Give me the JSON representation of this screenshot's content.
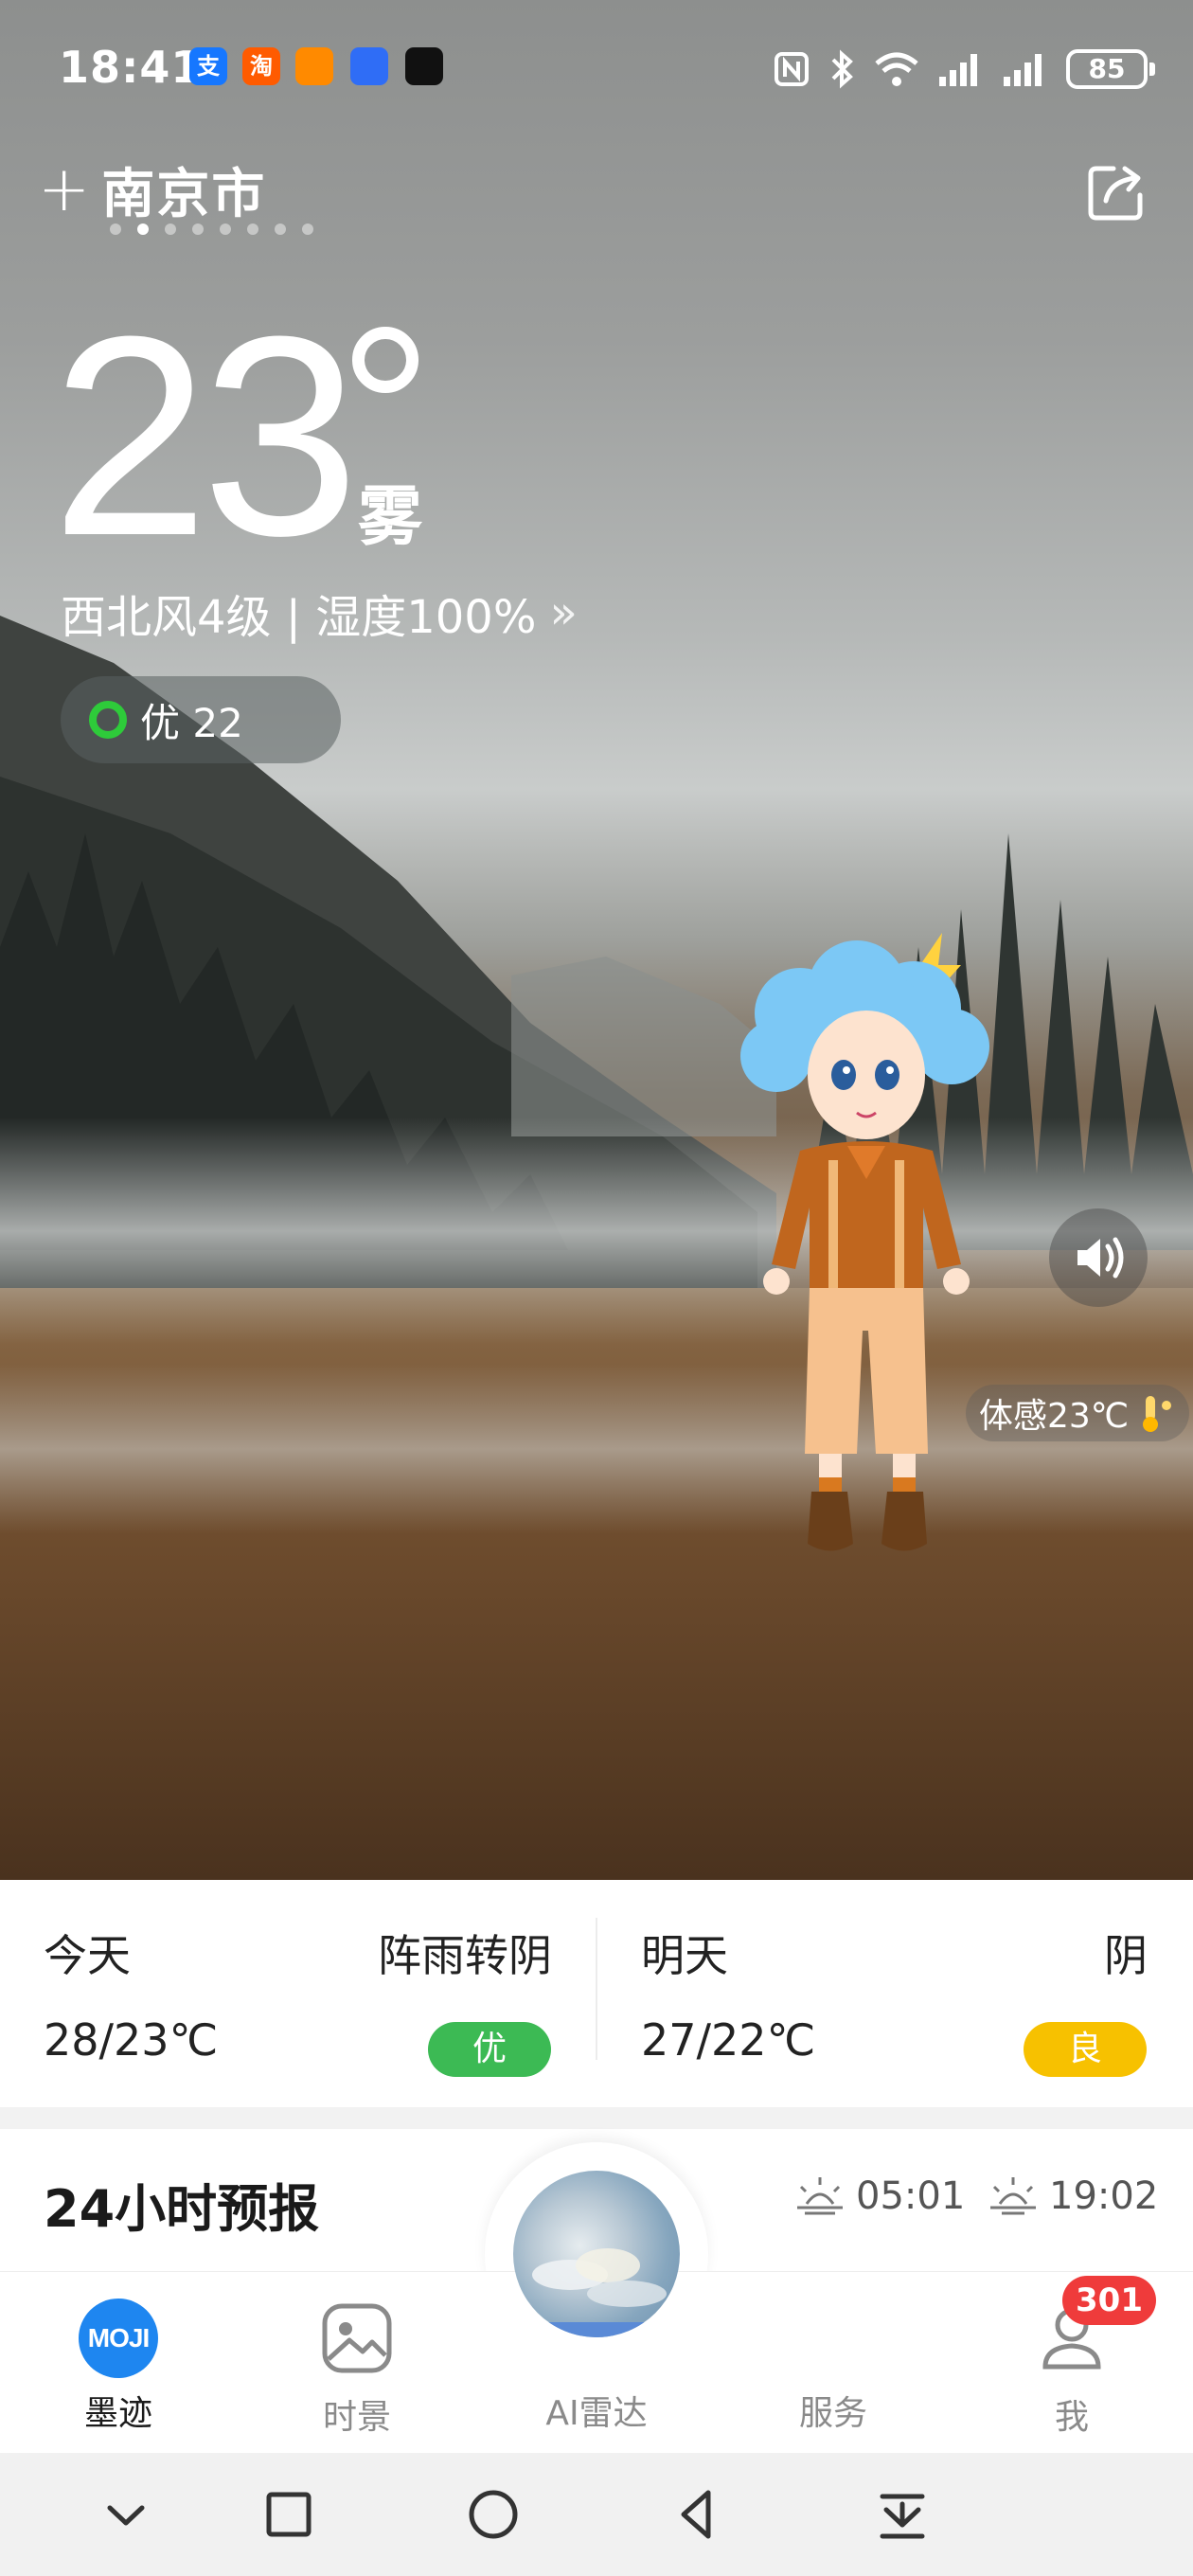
{
  "status_bar": {
    "time": "18:41",
    "app_icons": [
      "支",
      "淘",
      "",
      "",
      ""
    ],
    "battery": "85"
  },
  "header": {
    "add_symbol": "+",
    "city": "南京市",
    "page_count": 8,
    "active_page": 2
  },
  "current": {
    "temperature": "23",
    "condition": "雾",
    "wind_humidity": "西北风4级 | 湿度100%",
    "aqi_label": "优 22",
    "feels_like": "体感23℃"
  },
  "days": {
    "today": {
      "label": "今天",
      "condition": "阵雨转阴",
      "temp": "28/23℃",
      "aqi": "优",
      "aqi_color": "#3cba54"
    },
    "tomorrow": {
      "label": "明天",
      "condition": "阴",
      "temp": "27/22℃",
      "aqi": "良",
      "aqi_color": "#f7c100"
    }
  },
  "forecast": {
    "title": "24小时预报",
    "sunrise": "05:01",
    "sunset": "19:02"
  },
  "bottom_nav": {
    "items": [
      {
        "label": "墨迹",
        "icon": "moji-logo-icon",
        "logo_text": "MOJI"
      },
      {
        "label": "时景",
        "icon": "photo-icon"
      },
      {
        "label": "AI雷达",
        "icon": "ai-radar-icon"
      },
      {
        "label": "服务",
        "icon": "service-icon"
      },
      {
        "label": "我",
        "icon": "profile-icon"
      }
    ],
    "badge": "301"
  },
  "colors": {
    "accent_blue": "#1e86f0",
    "badge_red": "#ef3b3b",
    "aqi_green": "#2ecb3a"
  }
}
